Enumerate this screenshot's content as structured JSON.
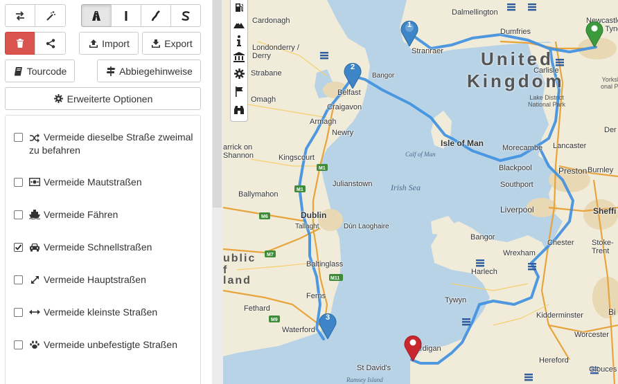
{
  "toolbar": {
    "row1": [
      {
        "name": "swap-icon"
      },
      {
        "name": "magic-wand-icon"
      },
      {
        "name": "road-icon",
        "active": true
      },
      {
        "name": "straight-line-icon"
      },
      {
        "name": "curve-icon"
      },
      {
        "name": "s-curve-icon"
      }
    ],
    "import_label": "Import",
    "export_label": "Export",
    "tourcode_label": "Tourcode",
    "directions_label": "Abbiegehinweise",
    "advanced_label": "Erweiterte Optionen"
  },
  "options": [
    {
      "icon": "shuffle-icon",
      "label": "Vermeide dieselbe Straße zweimal zu befahren",
      "checked": false
    },
    {
      "icon": "money-icon",
      "label": "Vermeide Mautstraßen",
      "checked": false
    },
    {
      "icon": "ship-icon",
      "label": "Vermeide Fähren",
      "checked": false
    },
    {
      "icon": "car-icon",
      "label": "Vermeide Schnellstraßen",
      "checked": true
    },
    {
      "icon": "expand-icon",
      "label": "Vermeide Hauptstraßen",
      "checked": false
    },
    {
      "icon": "arrows-h-icon",
      "label": "Vermeide kleinste Straßen",
      "checked": false
    },
    {
      "icon": "paw-icon",
      "label": "Vermeide unbefestigte Straßen",
      "checked": false
    }
  ],
  "map": {
    "toolbar_icons": [
      "fuel-icon",
      "mountain-icon",
      "info-icon",
      "museum-icon",
      "gear-icon",
      "flag-icon",
      "binoculars-icon"
    ],
    "country_labels": {
      "uk_line1": "United",
      "uk_line2": "Kingdom",
      "ie_line1": "ublic",
      "ie_line2": "f",
      "ie_line3": "land"
    },
    "sea_labels": {
      "irish_sea": "Irish Sea",
      "isle_of_man": "Isle of Man",
      "calf_of_man": "Calf of Man"
    },
    "park_labels": {
      "lake_district": "Lake District\nNational Park",
      "north_york": "Yorksh\nonal Pa"
    },
    "towns": [
      {
        "name": "Cardonagh"
      },
      {
        "name": "Londonderry /\nDerry"
      },
      {
        "name": "Strabane"
      },
      {
        "name": "Omagh"
      },
      {
        "name": "Dalmellington"
      },
      {
        "name": "Stranraer"
      },
      {
        "name": "Dumfries"
      },
      {
        "name": "Newcastle\nupon Tyne"
      },
      {
        "name": "Carlisle"
      },
      {
        "name": "Belfast"
      },
      {
        "name": "Bangor"
      },
      {
        "name": "Craigavon"
      },
      {
        "name": "Armagh"
      },
      {
        "name": "Newry"
      },
      {
        "name": "Kingscourt"
      },
      {
        "name": "arrick on\nShannon"
      },
      {
        "name": "Ballymahon"
      },
      {
        "name": "Julianstown"
      },
      {
        "name": "Dublin"
      },
      {
        "name": "Tallaght"
      },
      {
        "name": "Dún Laoghaire"
      },
      {
        "name": "Baltinglass"
      },
      {
        "name": "Ferns"
      },
      {
        "name": "Fethard"
      },
      {
        "name": "Waterford"
      },
      {
        "name": "Morecambe"
      },
      {
        "name": "Lancaster"
      },
      {
        "name": "Blackpool"
      },
      {
        "name": "Preston"
      },
      {
        "name": "Burnley"
      },
      {
        "name": "Southport"
      },
      {
        "name": "Liverpool"
      },
      {
        "name": "Sheffi"
      },
      {
        "name": "Bangor"
      },
      {
        "name": "Chester"
      },
      {
        "name": "Stoke-\nTrent"
      },
      {
        "name": "Wrexham"
      },
      {
        "name": "Harlech"
      },
      {
        "name": "Tywyn"
      },
      {
        "name": "Kidderminster"
      },
      {
        "name": "Worcester"
      },
      {
        "name": "Cardigan"
      },
      {
        "name": "St David's"
      },
      {
        "name": "Hereford"
      },
      {
        "name": "Glouces"
      },
      {
        "name": "Ramsey Island"
      },
      {
        "name": "Bi"
      },
      {
        "name": "Der"
      }
    ],
    "waypoints": [
      {
        "label": "1",
        "color": "#3d85c6"
      },
      {
        "label": "2",
        "color": "#3d85c6"
      },
      {
        "label": "3",
        "color": "#3d85c6"
      },
      {
        "label": "",
        "color": "#3c9a3c"
      },
      {
        "label": "",
        "color": "#c9272e"
      }
    ],
    "road_shields": [
      "M1",
      "M1",
      "M6",
      "M7",
      "M9",
      "M11"
    ],
    "colors": {
      "route": "#3d8fe0",
      "sea": "#b9d3e6",
      "land": "#f1ecd9",
      "urban": "#e8d8b4",
      "motorway": "#e7a43c"
    }
  }
}
